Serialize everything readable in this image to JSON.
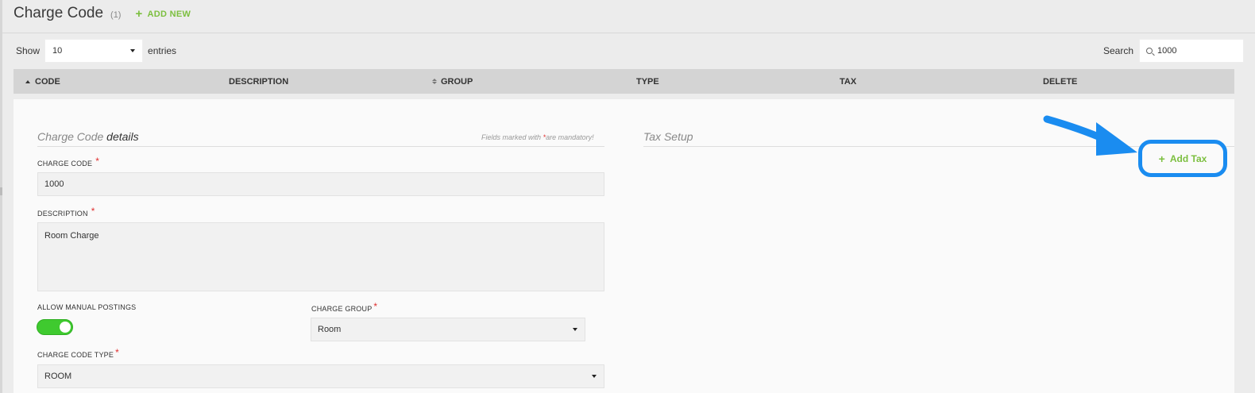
{
  "header": {
    "title": "Charge Code",
    "count": "(1)",
    "add_new_label": "ADD NEW"
  },
  "controls": {
    "show_label": "Show",
    "entries_value": "10",
    "entries_label": "entries",
    "search_label": "Search",
    "search_value": "1000"
  },
  "table": {
    "columns": [
      "CODE",
      "DESCRIPTION",
      "GROUP",
      "TYPE",
      "TAX",
      "DELETE"
    ]
  },
  "details": {
    "title_part1": "Charge Code",
    "title_part2": "details",
    "mandatory_prefix": "Fields marked with",
    "mandatory_star": "*",
    "mandatory_suffix": "are mandatory!",
    "charge_code_label": "CHARGE CODE",
    "charge_code_value": "1000",
    "description_label": "DESCRIPTION",
    "description_value": "Room Charge",
    "allow_manual_label": "ALLOW MANUAL POSTINGS",
    "allow_manual_on": true,
    "charge_group_label": "CHARGE GROUP",
    "charge_group_value": "Room",
    "charge_code_type_label": "CHARGE CODE TYPE",
    "charge_code_type_value": "ROOM",
    "required_star": "*"
  },
  "tax_setup": {
    "title": "Tax Setup",
    "add_tax_label": "Add Tax"
  },
  "colors": {
    "accent_green": "#7cbf3f",
    "toggle_green": "#3fca2f",
    "highlight_blue": "#1a8cf0",
    "required_red": "#e03030"
  }
}
